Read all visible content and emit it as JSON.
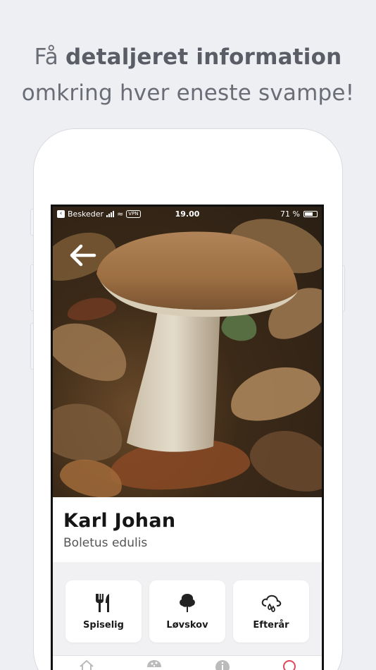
{
  "headline": {
    "line1_prefix": "Få ",
    "line1_bold": "detaljeret information",
    "line2": "omkring hver eneste svampe!"
  },
  "status_bar": {
    "back_app": "Beskeder",
    "vpn": "VPN",
    "time": "19.00",
    "battery": "71 %"
  },
  "mushroom": {
    "name": "Karl Johan",
    "latin": "Boletus edulis"
  },
  "properties": [
    {
      "label": "Spiselig",
      "icon": "fork-knife-icon"
    },
    {
      "label": "Løvskov",
      "icon": "tree-icon"
    },
    {
      "label": "Efterår",
      "icon": "cloud-rain-icon"
    }
  ],
  "tabs": [
    {
      "icon": "home-icon"
    },
    {
      "icon": "mushroom-icon"
    },
    {
      "icon": "info-icon"
    },
    {
      "icon": "search-icon",
      "active": true
    }
  ],
  "colors": {
    "background": "#eeeff3",
    "accent_tab": "#e0455a"
  }
}
